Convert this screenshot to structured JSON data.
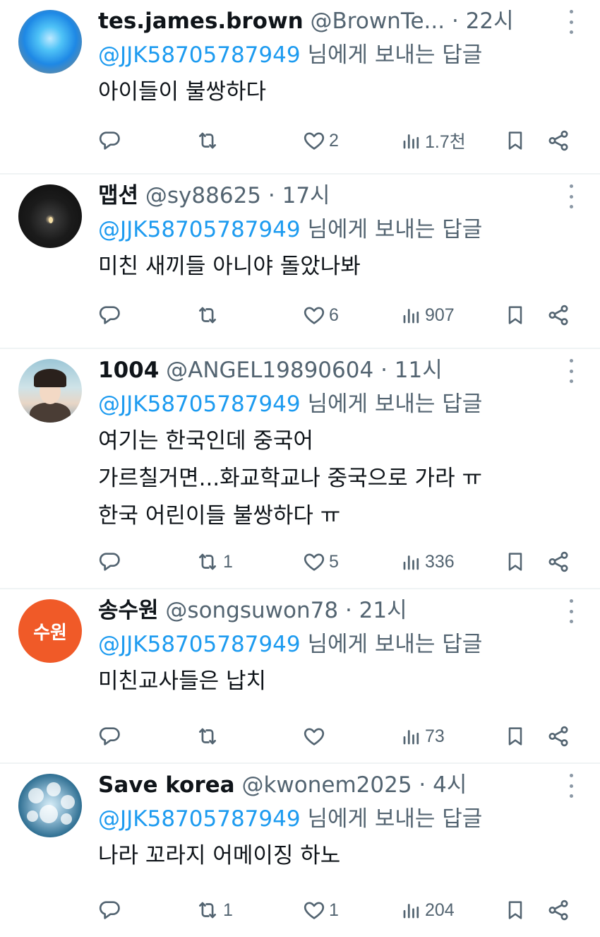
{
  "reply_prefix": "님에게 보내는 답글",
  "colors": {
    "accent": "#1d9bf0",
    "secondary_text": "#536471",
    "primary_text": "#0f1419",
    "divider": "#eff3f4"
  },
  "icons": {
    "reply": "reply-icon",
    "repost": "repost-icon",
    "like": "heart-icon",
    "views": "views-icon",
    "bookmark": "bookmark-icon",
    "share": "share-icon",
    "more": "more-icon"
  },
  "tweets": [
    {
      "name": "tes.james.brown",
      "handle": "@BrownTe...",
      "time": "22시",
      "mention": "@JJK58705787949",
      "body": [
        "아이들이 불쌍하다"
      ],
      "reposts": "",
      "likes": "2",
      "views": "1.7천"
    },
    {
      "name": "맵션",
      "handle": "@sy88625",
      "time": "17시",
      "mention": "@JJK58705787949",
      "body": [
        "미친 새끼들 아니야 돌았나봐"
      ],
      "reposts": "",
      "likes": "6",
      "views": "907"
    },
    {
      "name": "1004",
      "handle": "@ANGEL19890604",
      "time": "11시",
      "mention": "@JJK58705787949",
      "body": [
        "여기는 한국인데 중국어",
        "가르칠거면...화교학교나 중국으로 가라 ㅠ",
        "한국 어린이들 불쌍하다 ㅠ"
      ],
      "reposts": "1",
      "likes": "5",
      "views": "336"
    },
    {
      "name": "송수원",
      "handle": "@songsuwon78",
      "time": "21시",
      "avatar_text": "수원",
      "mention": "@JJK58705787949",
      "body": [
        "미친교사들은 납치"
      ],
      "reposts": "",
      "likes": "",
      "views": "73"
    },
    {
      "name": "Save korea",
      "handle": "@kwonem2025",
      "time": "4시",
      "mention": "@JJK58705787949",
      "body": [
        "나라 꼬라지 어메이징 하노"
      ],
      "reposts": "1",
      "likes": "1",
      "views": "204"
    }
  ]
}
